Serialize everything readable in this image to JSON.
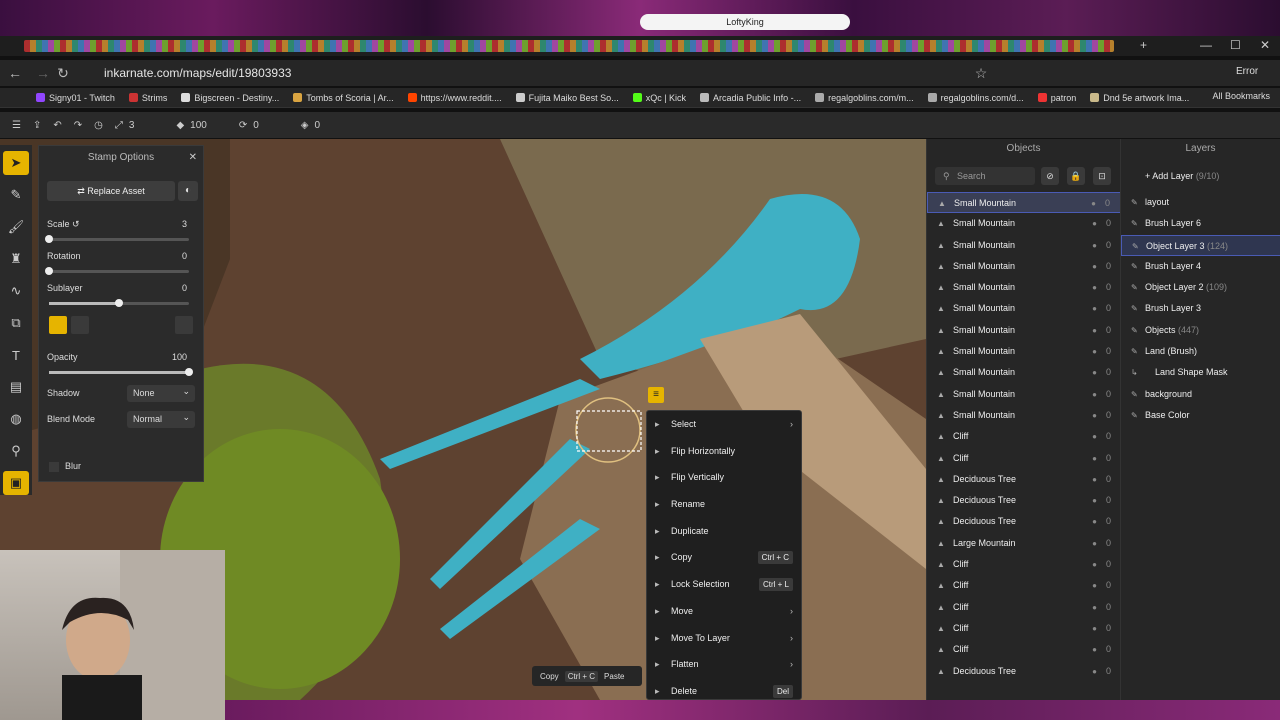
{
  "browser": {
    "banner_title": "LoftyKing",
    "url": "inkarnate.com/maps/edit/19803933",
    "profile": "Error",
    "bookmarks": [
      "Signy01 - Twitch",
      "Strims",
      "Bigscreen - Destiny...",
      "Tombs of Scoria | Ar...",
      "https://www.reddit....",
      "Fujita Maiko Best So...",
      "xQc | Kick",
      "Arcadia Public Info -...",
      "regalgoblins.com/m...",
      "regalgoblins.com/d...",
      "patron",
      "Dnd 5e artwork Ima..."
    ],
    "all_bookmarks": "All Bookmarks"
  },
  "toolbar": {
    "brush_size": "3",
    "zoom": "100",
    "rotation": "0",
    "layers": "0"
  },
  "stamp_options": {
    "title": "Stamp Options",
    "replace_asset": "Replace Asset",
    "scale_label": "Scale",
    "scale_value": "3",
    "rotation_label": "Rotation",
    "rotation_value": "0",
    "sublayer_label": "Sublayer",
    "sublayer_value": "0",
    "opacity_label": "Opacity",
    "opacity_value": "100",
    "shadow_label": "Shadow",
    "shadow_value": "None",
    "blend_label": "Blend Mode",
    "blend_value": "Normal",
    "blur_label": "Blur",
    "sliders": {
      "scale": 0.0,
      "rotation": 0.0,
      "sublayer": 0.5,
      "opacity": 1.0
    }
  },
  "objects": {
    "title": "Objects",
    "search_placeholder": "Search",
    "items": [
      {
        "name": "Small Mountain",
        "v": "0"
      },
      {
        "name": "Small Mountain",
        "v": "0"
      },
      {
        "name": "Small Mountain",
        "v": "0"
      },
      {
        "name": "Small Mountain",
        "v": "0"
      },
      {
        "name": "Small Mountain",
        "v": "0"
      },
      {
        "name": "Small Mountain",
        "v": "0"
      },
      {
        "name": "Small Mountain",
        "v": "0"
      },
      {
        "name": "Small Mountain",
        "v": "0"
      },
      {
        "name": "Small Mountain",
        "v": "0"
      },
      {
        "name": "Small Mountain",
        "v": "0"
      },
      {
        "name": "Small Mountain",
        "v": "0"
      },
      {
        "name": "Cliff",
        "v": "0"
      },
      {
        "name": "Cliff",
        "v": "0"
      },
      {
        "name": "Deciduous Tree",
        "v": "0"
      },
      {
        "name": "Deciduous Tree",
        "v": "0"
      },
      {
        "name": "Deciduous Tree",
        "v": "0"
      },
      {
        "name": "Large Mountain",
        "v": "0"
      },
      {
        "name": "Cliff",
        "v": "0"
      },
      {
        "name": "Cliff",
        "v": "0"
      },
      {
        "name": "Cliff",
        "v": "0"
      },
      {
        "name": "Cliff",
        "v": "0"
      },
      {
        "name": "Cliff",
        "v": "0"
      },
      {
        "name": "Deciduous Tree",
        "v": "0"
      }
    ]
  },
  "layers": {
    "title": "Layers",
    "add_layer": "Add Layer",
    "add_layer_count": "(9/10)",
    "items": [
      {
        "name": "layout",
        "count": ""
      },
      {
        "name": "Brush Layer 6",
        "count": ""
      },
      {
        "name": "Object Layer 3",
        "count": "(124)"
      },
      {
        "name": "Brush Layer 4",
        "count": ""
      },
      {
        "name": "Object Layer 2",
        "count": "(109)"
      },
      {
        "name": "Brush Layer 3",
        "count": ""
      },
      {
        "name": "Objects",
        "count": "(447)"
      },
      {
        "name": "Land (Brush)",
        "count": ""
      },
      {
        "name": "Land Shape Mask",
        "count": ""
      },
      {
        "name": "background",
        "count": ""
      },
      {
        "name": "Base Color",
        "count": ""
      }
    ]
  },
  "context_menu": {
    "items": [
      {
        "label": "Select",
        "kbd": "",
        "sub": true
      },
      {
        "label": "Flip Horizontally",
        "kbd": "",
        "sub": false
      },
      {
        "label": "Flip Vertically",
        "kbd": "",
        "sub": false
      },
      {
        "label": "Rename",
        "kbd": "",
        "sub": false
      },
      {
        "label": "Duplicate",
        "kbd": "",
        "sub": false
      },
      {
        "label": "Copy",
        "kbd": "Ctrl + C",
        "sub": false
      },
      {
        "label": "Lock Selection",
        "kbd": "Ctrl + L",
        "sub": false
      },
      {
        "label": "Move",
        "kbd": "",
        "sub": true
      },
      {
        "label": "Move To Layer",
        "kbd": "",
        "sub": true
      },
      {
        "label": "Flatten",
        "kbd": "",
        "sub": true
      },
      {
        "label": "Delete",
        "kbd": "Del",
        "sub": false
      }
    ]
  },
  "copybar": {
    "copy": "Copy",
    "copy_kbd": "Ctrl + C",
    "paste": "Paste"
  },
  "colors": {
    "accent": "#e6b400",
    "selection": "#4a5bb5",
    "water": "#3fb0c4"
  }
}
